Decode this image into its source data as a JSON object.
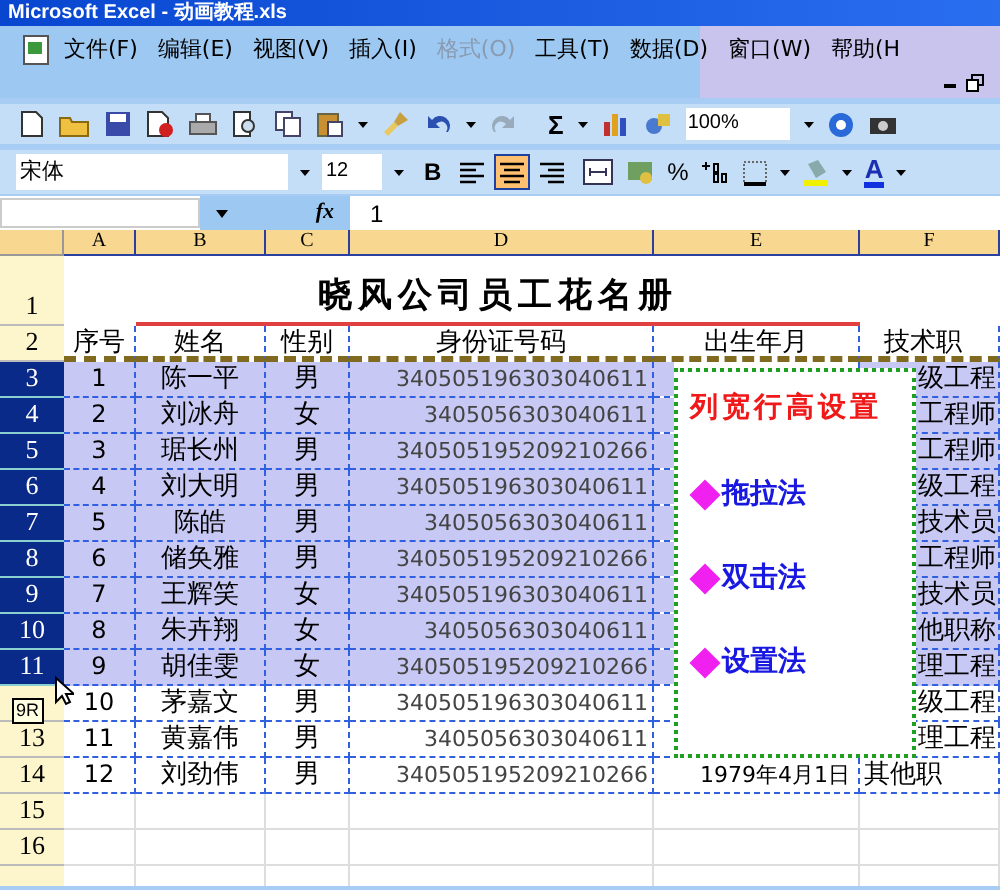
{
  "window": {
    "title": "Microsoft Excel - 动画教程.xls"
  },
  "menu": [
    {
      "label": "文件(F)",
      "disabled": false
    },
    {
      "label": "编辑(E)",
      "disabled": false
    },
    {
      "label": "视图(V)",
      "disabled": false
    },
    {
      "label": "插入(I)",
      "disabled": false
    },
    {
      "label": "格式(O)",
      "disabled": true
    },
    {
      "label": "工具(T)",
      "disabled": false
    },
    {
      "label": "数据(D)",
      "disabled": false
    },
    {
      "label": "窗口(W)",
      "disabled": false
    },
    {
      "label": "帮助(H",
      "disabled": false
    }
  ],
  "standard_toolbar": {
    "sum": "Σ",
    "zoom": "100%"
  },
  "formatting_toolbar": {
    "font": "宋体",
    "size": "12",
    "bold": "B",
    "percent": "%",
    "font_color": "A",
    "alignment": [
      {
        "kind": "left",
        "selected": false
      },
      {
        "kind": "center",
        "selected": true
      },
      {
        "kind": "right",
        "selected": false
      }
    ]
  },
  "formula_bar": {
    "fx": "fx",
    "value": "1"
  },
  "sheet": {
    "columns": [
      "A",
      "B",
      "C",
      "D",
      "E",
      "F"
    ],
    "title_row": {
      "row": "1",
      "text": "晓风公司员工花名册"
    },
    "header_row": {
      "row": "2",
      "cells": [
        "序号",
        "姓名",
        "性别",
        "身份证号码",
        "出生年月",
        "技术职"
      ]
    },
    "rows": [
      {
        "row": "3",
        "selected": true,
        "no": "1",
        "name": "陈一平",
        "gender": "男",
        "id": "340505196303040611",
        "title": "级工程"
      },
      {
        "row": "4",
        "selected": true,
        "no": "2",
        "name": "刘冰舟",
        "gender": "女",
        "id": "3405056303040611",
        "title": "工程师"
      },
      {
        "row": "5",
        "selected": true,
        "no": "3",
        "name": "琚长州",
        "gender": "男",
        "id": "340505195209210266",
        "title": "工程师"
      },
      {
        "row": "6",
        "selected": true,
        "no": "4",
        "name": "刘大明",
        "gender": "男",
        "id": "340505196303040611",
        "title": "级工程"
      },
      {
        "row": "7",
        "selected": true,
        "no": "5",
        "name": "陈皓",
        "gender": "男",
        "id": "3405056303040611",
        "title": "技术员"
      },
      {
        "row": "8",
        "selected": true,
        "no": "6",
        "name": "储奂雅",
        "gender": "男",
        "id": "340505195209210266",
        "title": "工程师"
      },
      {
        "row": "9",
        "selected": true,
        "no": "7",
        "name": "王辉笑",
        "gender": "女",
        "id": "340505196303040611",
        "title": "技术员"
      },
      {
        "row": "10",
        "selected": true,
        "no": "8",
        "name": "朱卉翔",
        "gender": "女",
        "id": "3405056303040611",
        "title": "他职称"
      },
      {
        "row": "11",
        "selected": true,
        "no": "9",
        "name": "胡佳雯",
        "gender": "女",
        "id": "340505195209210266",
        "title": "理工程"
      },
      {
        "selected": false,
        "no": "10",
        "name": "茅嘉文",
        "gender": "男",
        "id": "340505196303040611",
        "title": "级工程"
      },
      {
        "row": "13",
        "selected": false,
        "no": "11",
        "name": "黄嘉伟",
        "gender": "男",
        "id": "3405056303040611",
        "title": "理工程"
      },
      {
        "row": "14",
        "selected": false,
        "no": "12",
        "name": "刘劲伟",
        "gender": "男",
        "id": "340505195209210266",
        "birth": "1979年4月1日",
        "title": "其他职"
      }
    ],
    "empty_rows": [
      "15",
      "16"
    ]
  },
  "row_height_tooltip": "9R",
  "overlay": {
    "title": "列宽行高设置",
    "items": [
      "拖拉法",
      "双击法",
      "设置法"
    ]
  }
}
